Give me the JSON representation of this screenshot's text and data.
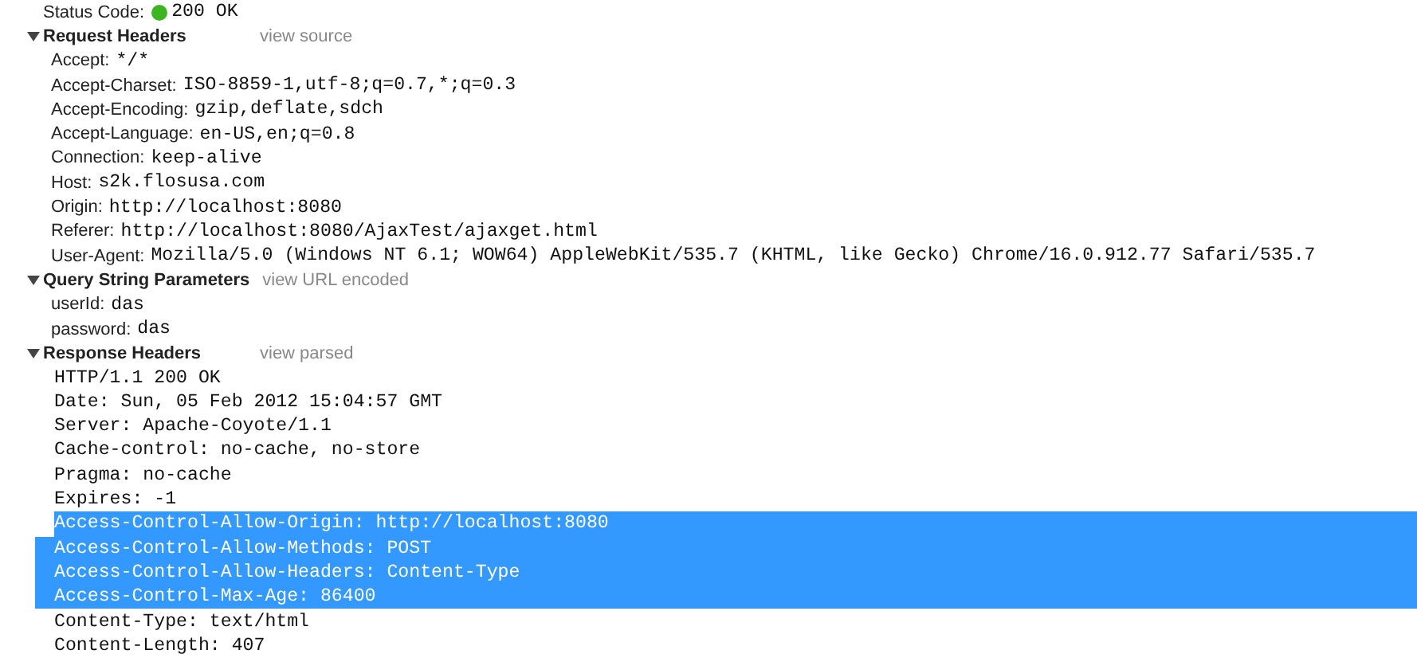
{
  "status": {
    "label": "Status Code:",
    "code": "200 OK",
    "color": "#3cb521"
  },
  "sections": [
    {
      "title": "Request Headers",
      "expanded": true,
      "link": "view source",
      "kind": "pairs",
      "items": [
        {
          "name": "Accept:",
          "value": "*/*"
        },
        {
          "name": "Accept-Charset:",
          "value": "ISO-8859-1,utf-8;q=0.7,*;q=0.3"
        },
        {
          "name": "Accept-Encoding:",
          "value": "gzip,deflate,sdch"
        },
        {
          "name": "Accept-Language:",
          "value": "en-US,en;q=0.8"
        },
        {
          "name": "Connection:",
          "value": "keep-alive"
        },
        {
          "name": "Host:",
          "value": "s2k.flosusa.com"
        },
        {
          "name": "Origin:",
          "value": "http://localhost:8080"
        },
        {
          "name": "Referer:",
          "value": "http://localhost:8080/AjaxTest/ajaxget.html"
        },
        {
          "name": "User-Agent:",
          "value": "Mozilla/5.0 (Windows NT 6.1; WOW64) AppleWebKit/535.7 (KHTML, like Gecko) Chrome/16.0.912.77 Safari/535.7"
        }
      ]
    },
    {
      "title": "Query String Parameters",
      "expanded": true,
      "link": "view URL encoded",
      "kind": "pairs",
      "items": [
        {
          "name": "userId:",
          "value": "das"
        },
        {
          "name": "password:",
          "value": "das"
        }
      ]
    },
    {
      "title": "Response Headers",
      "expanded": true,
      "link": "view parsed",
      "kind": "raw",
      "lines": [
        {
          "text": "HTTP/1.1 200 OK",
          "selected": false
        },
        {
          "text": "Date: Sun, 05 Feb 2012 15:04:57 GMT",
          "selected": false
        },
        {
          "text": "Server: Apache-Coyote/1.1",
          "selected": false
        },
        {
          "text": "Cache-control: no-cache, no-store",
          "selected": false
        },
        {
          "text": "Pragma: no-cache",
          "selected": false
        },
        {
          "text": "Expires: -1",
          "selected": false
        },
        {
          "text": "Access-Control-Allow-Origin: http://localhost:8080",
          "selected": true
        },
        {
          "text": "Access-Control-Allow-Methods: POST",
          "selected": true
        },
        {
          "text": "Access-Control-Allow-Headers: Content-Type",
          "selected": true
        },
        {
          "text": "Access-Control-Max-Age: 86400",
          "selected": true
        },
        {
          "text": "Content-Type: text/html",
          "selected": false
        },
        {
          "text": "Content-Length: 407",
          "selected": false
        }
      ]
    }
  ]
}
